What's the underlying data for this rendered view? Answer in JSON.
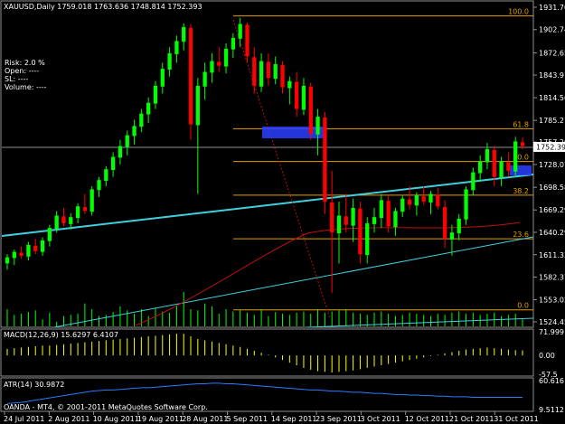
{
  "header": {
    "title": "XAUUSD,Daily  1759.018 1763.636 1748.814 1752.393"
  },
  "info": [
    "Risk:  2.0 %",
    "Open:    ----",
    "SL:      ----",
    "Volume:    ----"
  ],
  "macd_label": "MACD(12,26,9) 15.6297 6.4107",
  "atr_label": "ATR(14) 30.9872",
  "copyright": "OANDA - MT4, © 2001-2011 MetaQuotes Software Corp.",
  "colors": {
    "bull": "#00ff00",
    "bear": "#ff0000",
    "fib": "#e0a000",
    "trend": "#3fd0e0",
    "ma": "#c01010",
    "grid": "#808080",
    "macd": "#ffff00",
    "atr": "#2a7bff",
    "zone": "#2a40ff"
  },
  "chart_data": {
    "type": "candlestick",
    "price_axis": [
      1931.7,
      1902.74,
      1872.65,
      1843.91,
      1814.56,
      1785.21,
      1757.2,
      1728.07,
      1698.58,
      1669.29,
      1640.29,
      1611.33,
      1582.37,
      1553.02,
      1524.45
    ],
    "price_range": [
      1524.45,
      1931.7
    ],
    "current_price": "1752.39",
    "date_labels": [
      "24 Jul 2011",
      "2 Aug 2011",
      "10 Aug 2011",
      "19 Aug 2011",
      "28 Aug 2011",
      "5 Sep 2011",
      "14 Sep 2011",
      "23 Sep 2011",
      "3 Oct 2011",
      "12 Oct 2011",
      "21 Oct 2011",
      "31 Oct 2011"
    ],
    "fib_levels": [
      {
        "label": "100.0",
        "price": 1920.5
      },
      {
        "label": "61.8",
        "price": 1774.5
      },
      {
        "label": "50.0",
        "price": 1732
      },
      {
        "label": "38.2",
        "price": 1688.5
      },
      {
        "label": "23.6",
        "price": 1632
      },
      {
        "label": "0.0",
        "price": 1540
      }
    ],
    "ohlc": [
      [
        1600,
        1612,
        1592,
        1608
      ],
      [
        1607,
        1618,
        1598,
        1615
      ],
      [
        1614,
        1622,
        1606,
        1610
      ],
      [
        1609,
        1628,
        1604,
        1624
      ],
      [
        1623,
        1632,
        1612,
        1616
      ],
      [
        1615,
        1634,
        1610,
        1630
      ],
      [
        1629,
        1650,
        1622,
        1646
      ],
      [
        1645,
        1668,
        1640,
        1662
      ],
      [
        1661,
        1672,
        1648,
        1652
      ],
      [
        1651,
        1665,
        1644,
        1660
      ],
      [
        1659,
        1678,
        1652,
        1674
      ],
      [
        1673,
        1690,
        1664,
        1668
      ],
      [
        1667,
        1700,
        1662,
        1696
      ],
      [
        1695,
        1712,
        1686,
        1708
      ],
      [
        1707,
        1726,
        1700,
        1722
      ],
      [
        1721,
        1744,
        1712,
        1738
      ],
      [
        1737,
        1760,
        1728,
        1752
      ],
      [
        1751,
        1772,
        1740,
        1766
      ],
      [
        1765,
        1786,
        1754,
        1778
      ],
      [
        1777,
        1800,
        1770,
        1794
      ],
      [
        1793,
        1815,
        1782,
        1808
      ],
      [
        1807,
        1836,
        1800,
        1830
      ],
      [
        1829,
        1860,
        1820,
        1852
      ],
      [
        1851,
        1880,
        1842,
        1872
      ],
      [
        1871,
        1895,
        1860,
        1888
      ],
      [
        1887,
        1911,
        1876,
        1906
      ],
      [
        1905,
        1910,
        1760,
        1780
      ],
      [
        1779,
        1840,
        1690,
        1830
      ],
      [
        1829,
        1860,
        1812,
        1848
      ],
      [
        1847,
        1872,
        1834,
        1862
      ],
      [
        1861,
        1880,
        1848,
        1856
      ],
      [
        1855,
        1885,
        1846,
        1878
      ],
      [
        1877,
        1898,
        1866,
        1892
      ],
      [
        1891,
        1918,
        1880,
        1910
      ],
      [
        1909,
        1912,
        1860,
        1868
      ],
      [
        1867,
        1880,
        1820,
        1830
      ],
      [
        1829,
        1872,
        1822,
        1862
      ],
      [
        1861,
        1872,
        1830,
        1840
      ],
      [
        1839,
        1868,
        1832,
        1858
      ],
      [
        1857,
        1862,
        1820,
        1828
      ],
      [
        1827,
        1842,
        1806,
        1836
      ],
      [
        1835,
        1848,
        1790,
        1800
      ],
      [
        1799,
        1840,
        1792,
        1830
      ],
      [
        1829,
        1834,
        1760,
        1768
      ],
      [
        1767,
        1800,
        1740,
        1790
      ],
      [
        1789,
        1796,
        1664,
        1680
      ],
      [
        1679,
        1720,
        1562,
        1640
      ],
      [
        1639,
        1680,
        1600,
        1662
      ],
      [
        1661,
        1690,
        1640,
        1650
      ],
      [
        1649,
        1684,
        1628,
        1672
      ],
      [
        1671,
        1680,
        1600,
        1612
      ],
      [
        1611,
        1660,
        1600,
        1652
      ],
      [
        1651,
        1672,
        1640,
        1660
      ],
      [
        1659,
        1690,
        1646,
        1682
      ],
      [
        1681,
        1688,
        1640,
        1648
      ],
      [
        1647,
        1672,
        1636,
        1668
      ],
      [
        1667,
        1688,
        1660,
        1684
      ],
      [
        1683,
        1700,
        1670,
        1676
      ],
      [
        1675,
        1692,
        1662,
        1688
      ],
      [
        1687,
        1700,
        1676,
        1680
      ],
      [
        1679,
        1694,
        1664,
        1690
      ],
      [
        1689,
        1698,
        1670,
        1674
      ],
      [
        1673,
        1682,
        1620,
        1632
      ],
      [
        1631,
        1650,
        1610,
        1640
      ],
      [
        1639,
        1664,
        1630,
        1658
      ],
      [
        1657,
        1700,
        1650,
        1696
      ],
      [
        1695,
        1724,
        1688,
        1718
      ],
      [
        1717,
        1740,
        1706,
        1732
      ],
      [
        1731,
        1756,
        1722,
        1748
      ],
      [
        1747,
        1752,
        1700,
        1712
      ],
      [
        1711,
        1738,
        1700,
        1732
      ],
      [
        1731,
        1744,
        1712,
        1720
      ],
      [
        1719,
        1764,
        1714,
        1758
      ],
      [
        1757,
        1763,
        1748,
        1752
      ]
    ],
    "volume": [
      30,
      20,
      22,
      25,
      28,
      12,
      24,
      8,
      18,
      20,
      22,
      40,
      30,
      18,
      20,
      25,
      35,
      28,
      22,
      30,
      18,
      32,
      26,
      24,
      36,
      60,
      30,
      28,
      40,
      35,
      22,
      30,
      26,
      28,
      24,
      20,
      30,
      18,
      25,
      22,
      20,
      24,
      26,
      22,
      30,
      24,
      26,
      28,
      30,
      24,
      22,
      20,
      24,
      26,
      22,
      18,
      20,
      24,
      22,
      20,
      18,
      22,
      20,
      24,
      26,
      22,
      24,
      20,
      22,
      24,
      18,
      20,
      22,
      14
    ],
    "macd": {
      "range": [
        -57.5,
        71.99
      ],
      "axis": [
        "71.999",
        "0.00",
        "-57.5"
      ],
      "values": [
        20,
        22,
        24,
        26,
        28,
        30,
        30,
        32,
        34,
        36,
        38,
        40,
        42,
        44,
        46,
        48,
        50,
        52,
        54,
        56,
        58,
        60,
        62,
        64,
        66,
        66,
        58,
        50,
        46,
        42,
        38,
        34,
        30,
        26,
        20,
        14,
        8,
        2,
        -6,
        -14,
        -22,
        -30,
        -38,
        -44,
        -48,
        -50,
        -52,
        -50,
        -48,
        -46,
        -42,
        -38,
        -34,
        -30,
        -26,
        -22,
        -18,
        -14,
        -10,
        -6,
        -2,
        2,
        6,
        10,
        14,
        18,
        20,
        22,
        24,
        22,
        20,
        18,
        16,
        15.6
      ]
    },
    "atr": {
      "range": [
        9.51,
        60.61
      ],
      "axis": [
        "60.616",
        "9.5112"
      ],
      "values": [
        20,
        21,
        22,
        24,
        26,
        28,
        30,
        32,
        34,
        36,
        38,
        40,
        42,
        43,
        44,
        44,
        45,
        46,
        47,
        48,
        48,
        49,
        50,
        51,
        52,
        53,
        54,
        55,
        55,
        56,
        56,
        55,
        55,
        54,
        53,
        52,
        51,
        50,
        49,
        48,
        47,
        46,
        45,
        44,
        44,
        43,
        42,
        42,
        41,
        40,
        40,
        39,
        38,
        38,
        37,
        36,
        36,
        35,
        35,
        34,
        34,
        33,
        33,
        32,
        32,
        32,
        31,
        31,
        31,
        31,
        31,
        31,
        31,
        30.99
      ]
    }
  }
}
